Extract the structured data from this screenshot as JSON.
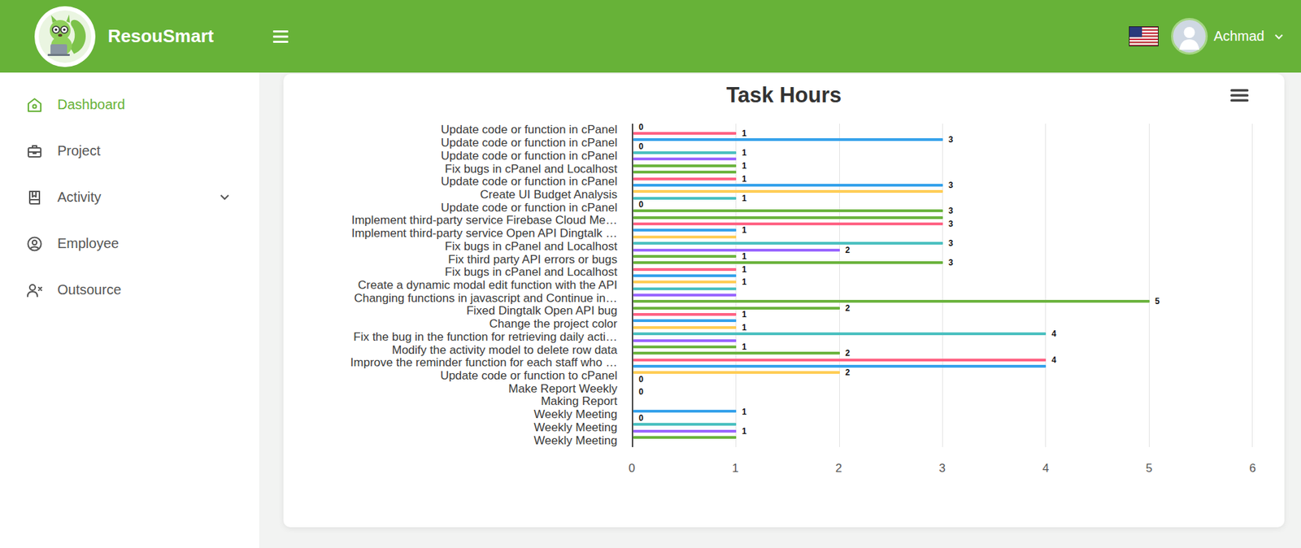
{
  "app": {
    "name": "ResouSmart"
  },
  "user": {
    "name": "Achmad"
  },
  "sidebar": {
    "items": [
      {
        "label": "Dashboard",
        "selected": true
      },
      {
        "label": "Project",
        "selected": false
      },
      {
        "label": "Activity",
        "selected": false,
        "expanded": false
      },
      {
        "label": "Employee",
        "selected": false
      },
      {
        "label": "Outsource",
        "selected": false
      }
    ]
  },
  "chart": {
    "title": "Task Hours",
    "x_ticks": [
      "0",
      "1",
      "2",
      "3",
      "4",
      "5",
      "6"
    ],
    "categories": [
      {
        "label": "Update code or function in cPanel",
        "bars": [
          {
            "value": 0,
            "color": "#6cb43f",
            "label": "0"
          },
          {
            "value": 1,
            "color": "#ff6384",
            "label": "1"
          }
        ]
      },
      {
        "label": "Update code or function in cPanel",
        "bars": [
          {
            "value": 3,
            "color": "#36a2eb",
            "label": "3"
          },
          {
            "value": 0,
            "color": "#ffcd56",
            "label": "0"
          }
        ]
      },
      {
        "label": "Update code or function in cPanel",
        "bars": [
          {
            "value": 1,
            "color": "#4bc0c0",
            "label": "1"
          },
          {
            "value": 1,
            "color": "#9966ff"
          }
        ]
      },
      {
        "label": "Fix bugs in cPanel and Localhost",
        "bars": [
          {
            "value": 1,
            "color": "#6cb43f",
            "label": "1"
          },
          {
            "value": 1,
            "color": "#6cb43f"
          }
        ]
      },
      {
        "label": "Update code or function in cPanel",
        "bars": [
          {
            "value": 1,
            "color": "#ff6384",
            "label": "1"
          },
          {
            "value": 3,
            "color": "#36a2eb",
            "label": "3"
          }
        ]
      },
      {
        "label": "Create UI Budget Analysis",
        "bars": [
          {
            "value": 3,
            "color": "#ffcd56"
          },
          {
            "value": 1,
            "color": "#4bc0c0",
            "label": "1"
          }
        ]
      },
      {
        "label": "Update code or function in cPanel",
        "bars": [
          {
            "value": 0,
            "color": "#9966ff",
            "label": "0"
          },
          {
            "value": 3,
            "color": "#6cb43f",
            "label": "3"
          }
        ]
      },
      {
        "label": "Implement third-party service Firebase Cloud Me…",
        "bars": [
          {
            "value": 3,
            "color": "#6cb43f"
          },
          {
            "value": 3,
            "color": "#ff6384",
            "label": "3"
          }
        ]
      },
      {
        "label": "Implement third-party service Open API Dingtalk …",
        "bars": [
          {
            "value": 1,
            "color": "#36a2eb",
            "label": "1"
          },
          {
            "value": 1,
            "color": "#ffcd56"
          }
        ]
      },
      {
        "label": "Fix bugs in cPanel and Localhost",
        "bars": [
          {
            "value": 3,
            "color": "#4bc0c0",
            "label": "3"
          },
          {
            "value": 2,
            "color": "#9966ff",
            "label": "2"
          }
        ]
      },
      {
        "label": "Fix third party API errors or bugs",
        "bars": [
          {
            "value": 1,
            "color": "#6cb43f",
            "label": "1"
          },
          {
            "value": 3,
            "color": "#6cb43f",
            "label": "3"
          }
        ]
      },
      {
        "label": "Fix bugs in cPanel and Localhost",
        "bars": [
          {
            "value": 1,
            "color": "#ff6384",
            "label": "1"
          },
          {
            "value": 1,
            "color": "#36a2eb"
          }
        ]
      },
      {
        "label": "Create a dynamic modal edit function with the API",
        "bars": [
          {
            "value": 1,
            "color": "#ffcd56",
            "label": "1"
          },
          {
            "value": 1,
            "color": "#4bc0c0"
          }
        ]
      },
      {
        "label": "Changing functions in javascript and Continue in…",
        "bars": [
          {
            "value": 1,
            "color": "#9966ff"
          },
          {
            "value": 5,
            "color": "#6cb43f",
            "label": "5"
          }
        ]
      },
      {
        "label": "Fixed Dingtalk Open API bug",
        "bars": [
          {
            "value": 2,
            "color": "#6cb43f",
            "label": "2"
          },
          {
            "value": 1,
            "color": "#ff6384",
            "label": "1"
          }
        ]
      },
      {
        "label": "Change the project color",
        "bars": [
          {
            "value": 1,
            "color": "#36a2eb"
          },
          {
            "value": 1,
            "color": "#ffcd56",
            "label": "1"
          }
        ]
      },
      {
        "label": "Fix the bug in the function for retrieving daily acti…",
        "bars": [
          {
            "value": 4,
            "color": "#4bc0c0",
            "label": "4"
          },
          {
            "value": 1,
            "color": "#9966ff"
          }
        ]
      },
      {
        "label": "Modify the activity model to delete row data",
        "bars": [
          {
            "value": 1,
            "color": "#6cb43f",
            "label": "1"
          },
          {
            "value": 2,
            "color": "#6cb43f",
            "label": "2"
          }
        ]
      },
      {
        "label": "Improve the reminder function for each staff who …",
        "bars": [
          {
            "value": 4,
            "color": "#ff6384",
            "label": "4"
          },
          {
            "value": 4,
            "color": "#36a2eb"
          }
        ]
      },
      {
        "label": "Update code or function to cPanel",
        "bars": [
          {
            "value": 2,
            "color": "#ffcd56",
            "label": "2"
          },
          {
            "value": 0,
            "color": "#4bc0c0",
            "label": "0"
          }
        ]
      },
      {
        "label": "Make Report Weekly",
        "bars": [
          {
            "value": 0,
            "color": "#9966ff"
          },
          {
            "value": 0,
            "color": "#6cb43f",
            "label": "0"
          }
        ]
      },
      {
        "label": "Making Report",
        "bars": [
          {
            "value": 0,
            "color": "#6cb43f"
          },
          {
            "value": 0,
            "color": "#ff6384"
          }
        ]
      },
      {
        "label": "Weekly Meeting",
        "bars": [
          {
            "value": 1,
            "color": "#36a2eb",
            "label": "1"
          },
          {
            "value": 0,
            "color": "#ffcd56",
            "label": "0"
          }
        ]
      },
      {
        "label": "Weekly Meeting",
        "bars": [
          {
            "value": 1,
            "color": "#4bc0c0"
          },
          {
            "value": 1,
            "color": "#9966ff",
            "label": "1"
          }
        ]
      },
      {
        "label": "Weekly Meeting",
        "bars": [
          {
            "value": 1,
            "color": "#6cb43f"
          },
          {
            "value": 0,
            "color": "#6cb43f"
          }
        ]
      }
    ]
  }
}
